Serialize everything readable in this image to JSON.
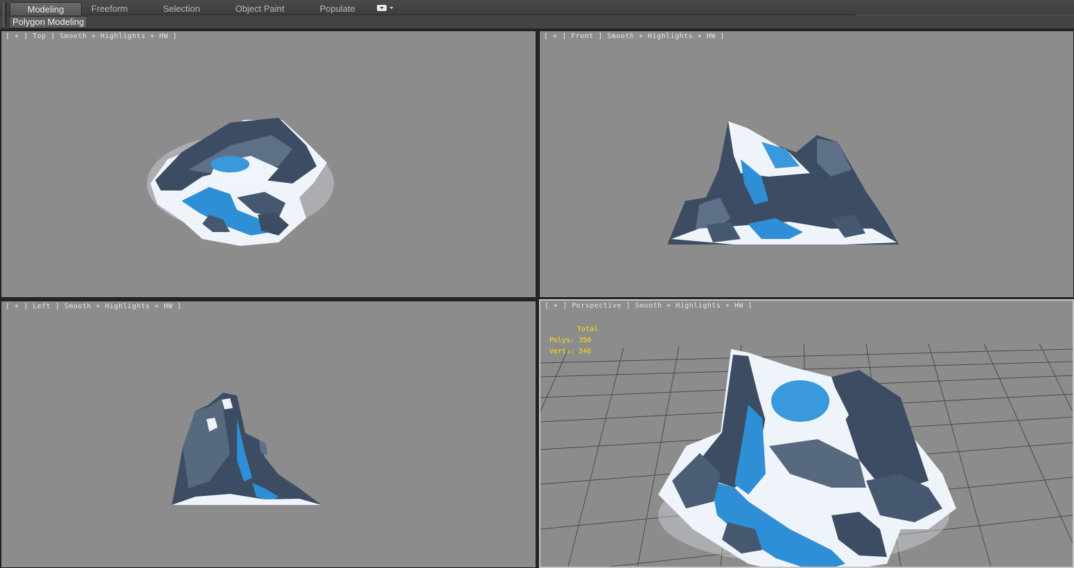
{
  "ribbon": {
    "tabs": [
      {
        "label": "Modeling",
        "active": true
      },
      {
        "label": "Freeform",
        "active": false
      },
      {
        "label": "Selection",
        "active": false
      },
      {
        "label": "Object Paint",
        "active": false
      },
      {
        "label": "Populate",
        "active": false
      }
    ],
    "menu_icon": "ribbon-options-icon",
    "panel_button": "Polygon Modeling"
  },
  "viewports": {
    "top": {
      "label": "[ + ] Top ] Smooth + Highlights + HW ]"
    },
    "front": {
      "label": "[ + ] Front ] Smooth + Highlights + HW ]"
    },
    "left": {
      "label": "[ + ] Left ] Smooth + Highlights + HW ]"
    },
    "perspective": {
      "label": "[ + ] Perspective ] Smooth + Highlights + HW ]",
      "stats": {
        "header": "Total",
        "polys_label": "Polys:",
        "polys_value": "350",
        "verts_label": "Verts:",
        "verts_value": "246"
      }
    }
  },
  "colors": {
    "viewport_bg": "#8c8c8c",
    "rock_dark": "#3a4a5e",
    "rock_mid": "#5c6f86",
    "snow": "#eef4fa",
    "water": "#2f8fd6",
    "stats_text": "#ffe000"
  }
}
